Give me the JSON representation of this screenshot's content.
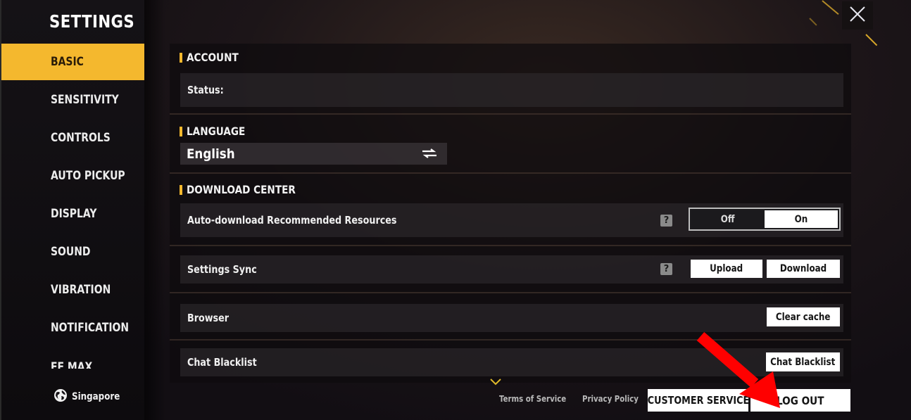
{
  "sidebar": {
    "title": "SETTINGS",
    "items": [
      {
        "label": "BASIC",
        "active": true
      },
      {
        "label": "SENSITIVITY"
      },
      {
        "label": "CONTROLS"
      },
      {
        "label": "AUTO PICKUP"
      },
      {
        "label": "DISPLAY"
      },
      {
        "label": "SOUND"
      },
      {
        "label": "VIBRATION"
      },
      {
        "label": "NOTIFICATION"
      },
      {
        "label": "FF MAX"
      }
    ],
    "region": {
      "icon": "globe-icon",
      "label": "Singapore"
    }
  },
  "close": {
    "icon": "close-icon"
  },
  "account": {
    "heading": "ACCOUNT",
    "status_label": "Status:"
  },
  "language": {
    "heading": "LANGUAGE",
    "selected": "English",
    "icon": "swap-arrows-icon"
  },
  "download_center": {
    "heading": "DOWNLOAD CENTER",
    "auto_download": {
      "label": "Auto-download Recommended Resources",
      "help": "?",
      "options": [
        "Off",
        "On"
      ],
      "selected": "On"
    },
    "settings_sync": {
      "label": "Settings Sync",
      "help": "?",
      "upload_label": "Upload",
      "download_label": "Download"
    },
    "browser": {
      "label": "Browser",
      "button_label": "Clear cache"
    },
    "chat_blacklist": {
      "label": "Chat Blacklist",
      "button_label": "Chat Blacklist"
    }
  },
  "footer": {
    "terms_label": "Terms of Service",
    "privacy_label": "Privacy Policy",
    "customer_service_label": "CUSTOMER SERVICE",
    "logout_label": "LOG OUT",
    "scroll_icon": "chevron-down-icon"
  },
  "colors": {
    "accent": "#f4b82e",
    "annotation_arrow": "#ff0000"
  }
}
